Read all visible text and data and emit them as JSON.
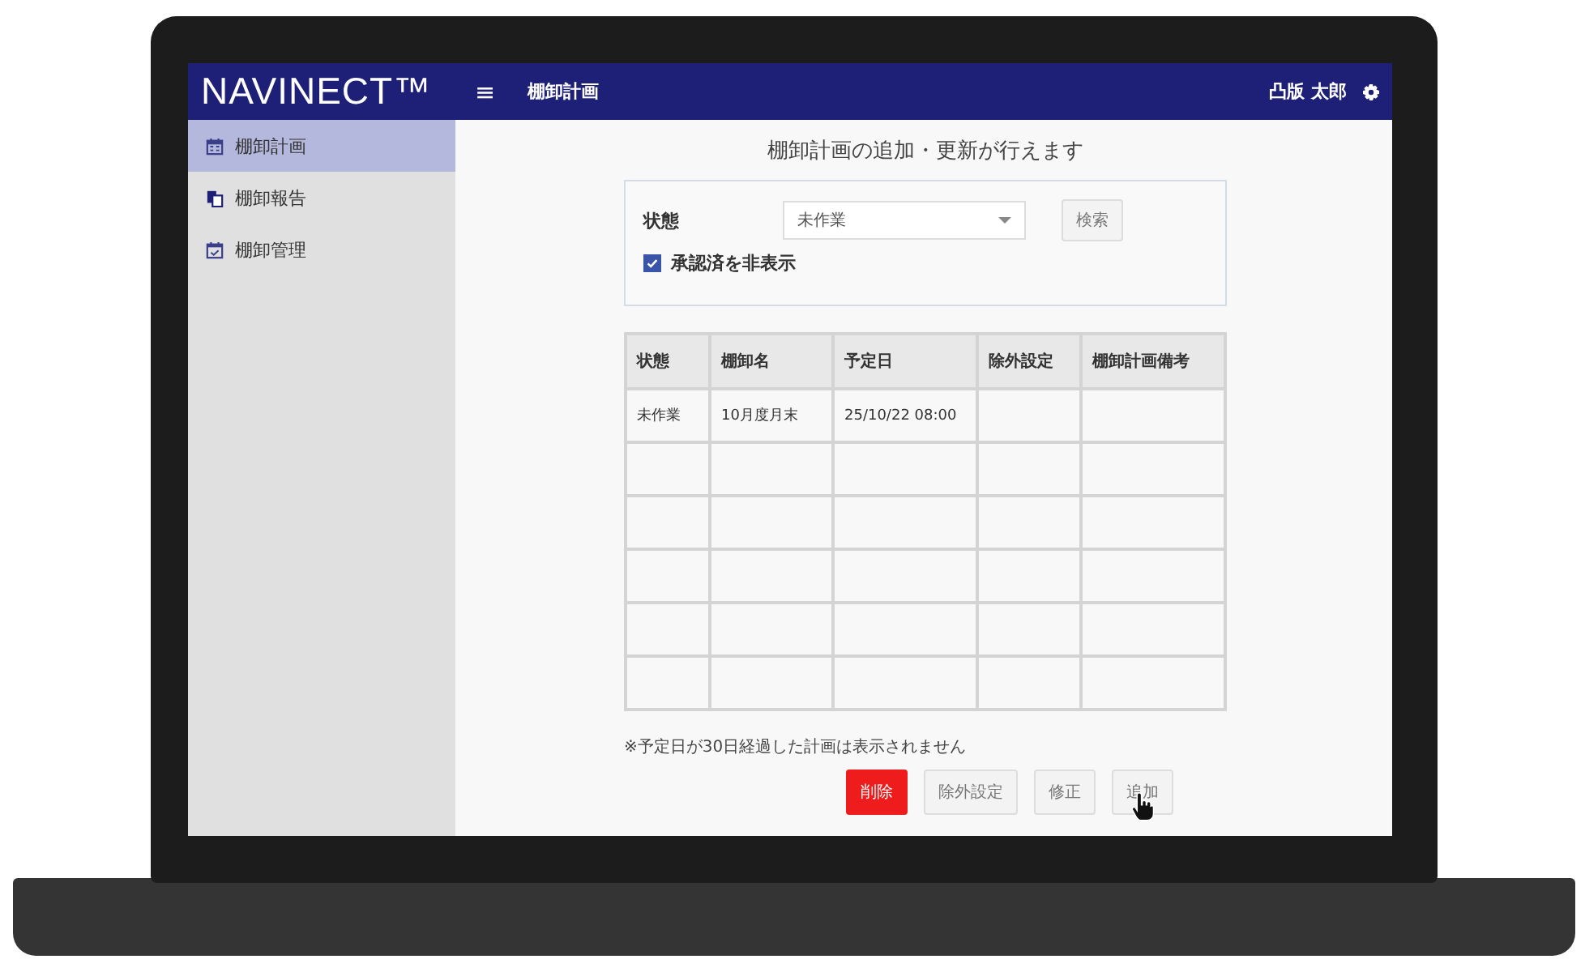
{
  "header": {
    "logo": "NAVINECT™",
    "menu_icon": "≡",
    "page_title": "棚卸計画",
    "user": "凸版 太郎"
  },
  "sidebar": {
    "items": [
      {
        "label": "棚卸計画",
        "kind": "calendar",
        "selected": true
      },
      {
        "label": "棚卸報告",
        "kind": "documents",
        "selected": false
      },
      {
        "label": "棚卸管理",
        "kind": "calendar-check",
        "selected": false
      }
    ]
  },
  "heading": "棚卸計画の追加・更新が行えます",
  "filter": {
    "status_label": "状態",
    "status_value": "未作業",
    "search_button": "検索",
    "hide_approved": {
      "label": "承認済を非表示",
      "checked": true
    }
  },
  "table": {
    "columns": [
      "状態",
      "棚卸名",
      "予定日",
      "除外設定",
      "棚卸計画備考"
    ],
    "rows": [
      [
        "未作業",
        "10月度月末",
        "25/10/22 08:00",
        "",
        ""
      ]
    ]
  },
  "note": "※予定日が30日経過した計画は表示されません",
  "buttons": [
    {
      "label": "削除",
      "kind": "danger"
    },
    {
      "label": "除外設定",
      "kind": "default"
    },
    {
      "label": "修正",
      "kind": "default"
    },
    {
      "label": "追加",
      "kind": "default"
    }
  ]
}
